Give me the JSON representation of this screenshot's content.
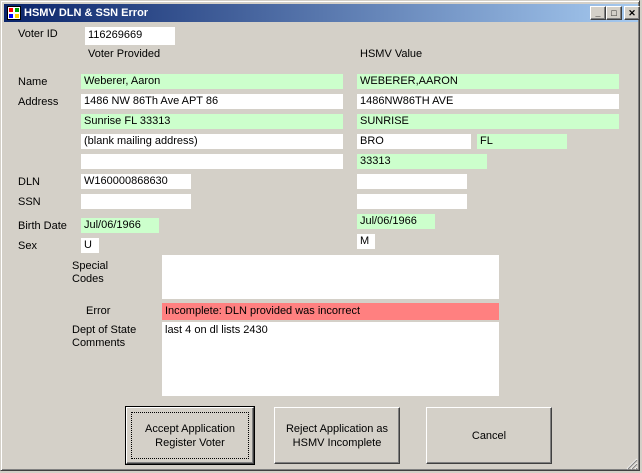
{
  "window": {
    "title": "HSMV DLN & SSN Error"
  },
  "controls": {
    "minimize": "_",
    "maximize": "□",
    "close": "✕"
  },
  "labels": {
    "voter_id": "Voter ID",
    "voter_provided": "Voter Provided",
    "hsmv_value": "HSMV Value",
    "name": "Name",
    "address": "Address",
    "dln": "DLN",
    "ssn": "SSN",
    "birth_date": "Birth Date",
    "sex": "Sex",
    "special_codes": "Special\nCodes",
    "error": "Error",
    "comments": "Dept of State\nComments"
  },
  "voter_id": "116269669",
  "voter": {
    "name": "Weberer, Aaron",
    "address1": "1486 NW 86Th Ave APT 86",
    "address2": "Sunrise FL 33313",
    "address3": "(blank mailing address)",
    "address4": "",
    "dln": "W160000868630",
    "ssn": "",
    "birth_date": "Jul/06/1966",
    "sex": "U"
  },
  "hsmv": {
    "name": "WEBERER,AARON",
    "address1": "1486NW86TH AVE",
    "city": "SUNRISE",
    "county": "BRO",
    "state": "FL",
    "zip": "33313",
    "dln": "",
    "ssn": "",
    "birth_date": "Jul/06/1966",
    "sex": "M"
  },
  "special_codes": "",
  "error": "Incomplete: DLN provided was incorrect",
  "comments": "last 4 on dl lists 2430",
  "buttons": {
    "accept": "Accept Application\nRegister Voter",
    "reject": "Reject Application as\nHSMV Incomplete",
    "cancel": "Cancel"
  },
  "colors": {
    "match": "#ccffcc",
    "error": "#ff8080",
    "titlebar": "#0a246a"
  }
}
